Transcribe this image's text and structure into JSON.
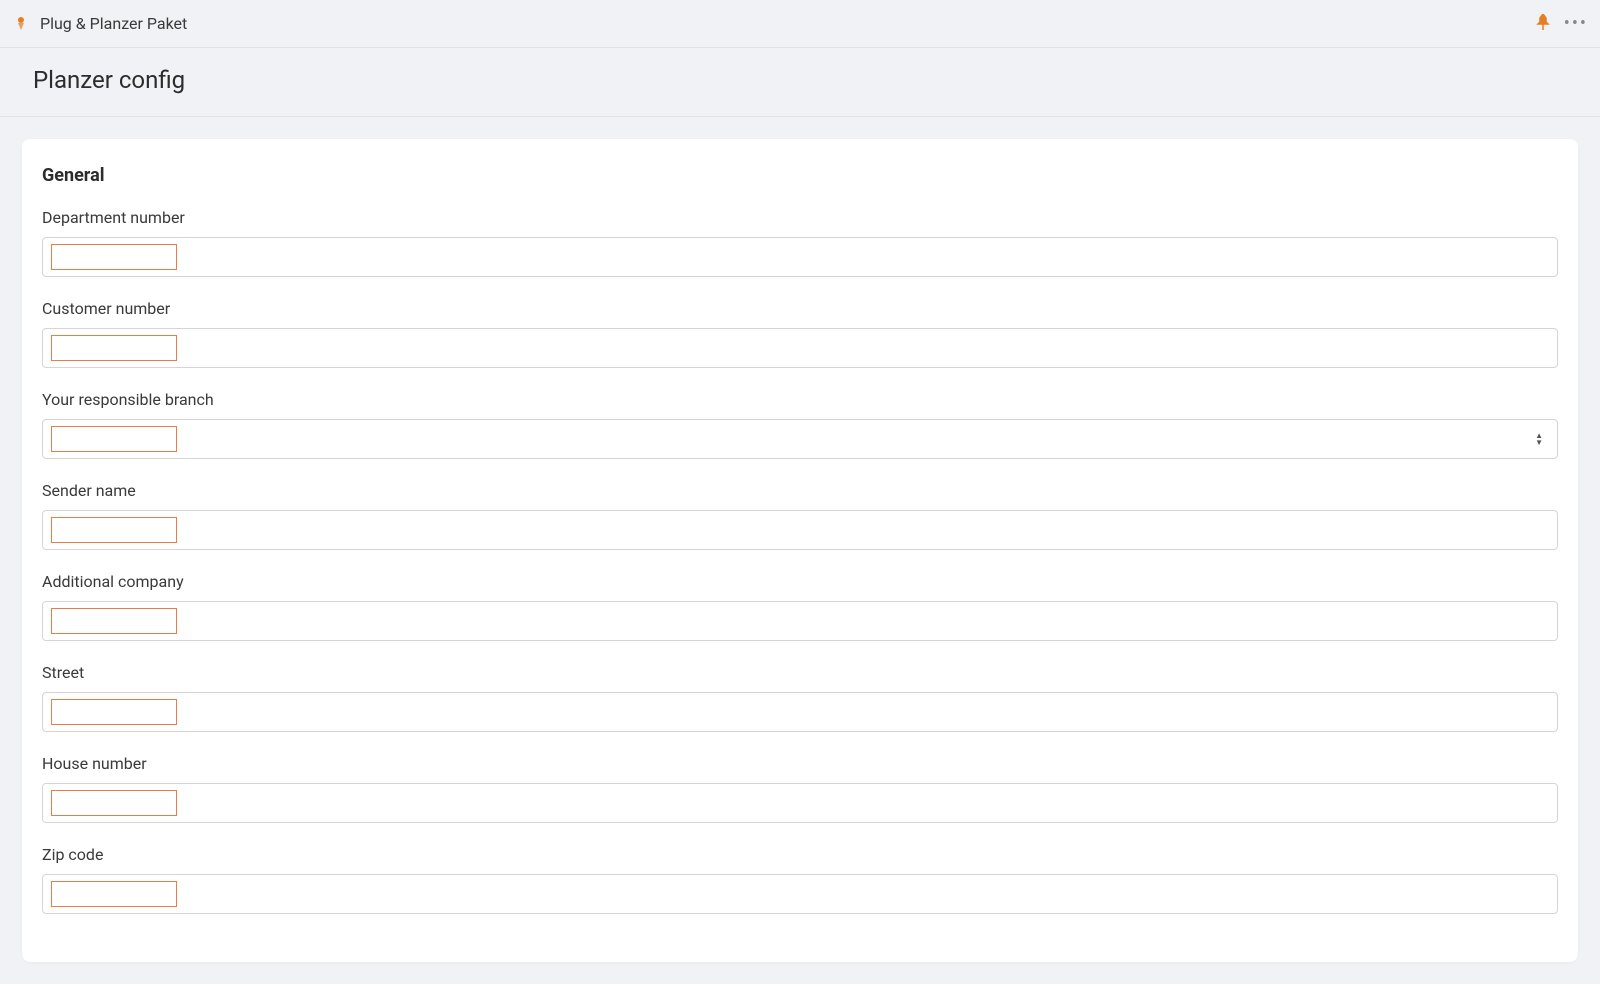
{
  "header": {
    "app_title": "Plug & Planzer Paket",
    "page_title": "Planzer config"
  },
  "section": {
    "title": "General"
  },
  "fields": {
    "department_number": {
      "label": "Department number",
      "value": ""
    },
    "customer_number": {
      "label": "Customer number",
      "value": ""
    },
    "responsible_branch": {
      "label": "Your responsible branch",
      "value": "",
      "type": "select"
    },
    "sender_name": {
      "label": "Sender name",
      "value": ""
    },
    "additional_company": {
      "label": "Additional company",
      "value": ""
    },
    "street": {
      "label": "Street",
      "value": ""
    },
    "house_number": {
      "label": "House number",
      "value": ""
    },
    "zip_code": {
      "label": "Zip code",
      "value": ""
    }
  },
  "colors": {
    "accent": "#e67e22",
    "input_highlight": "#e67e4a"
  }
}
